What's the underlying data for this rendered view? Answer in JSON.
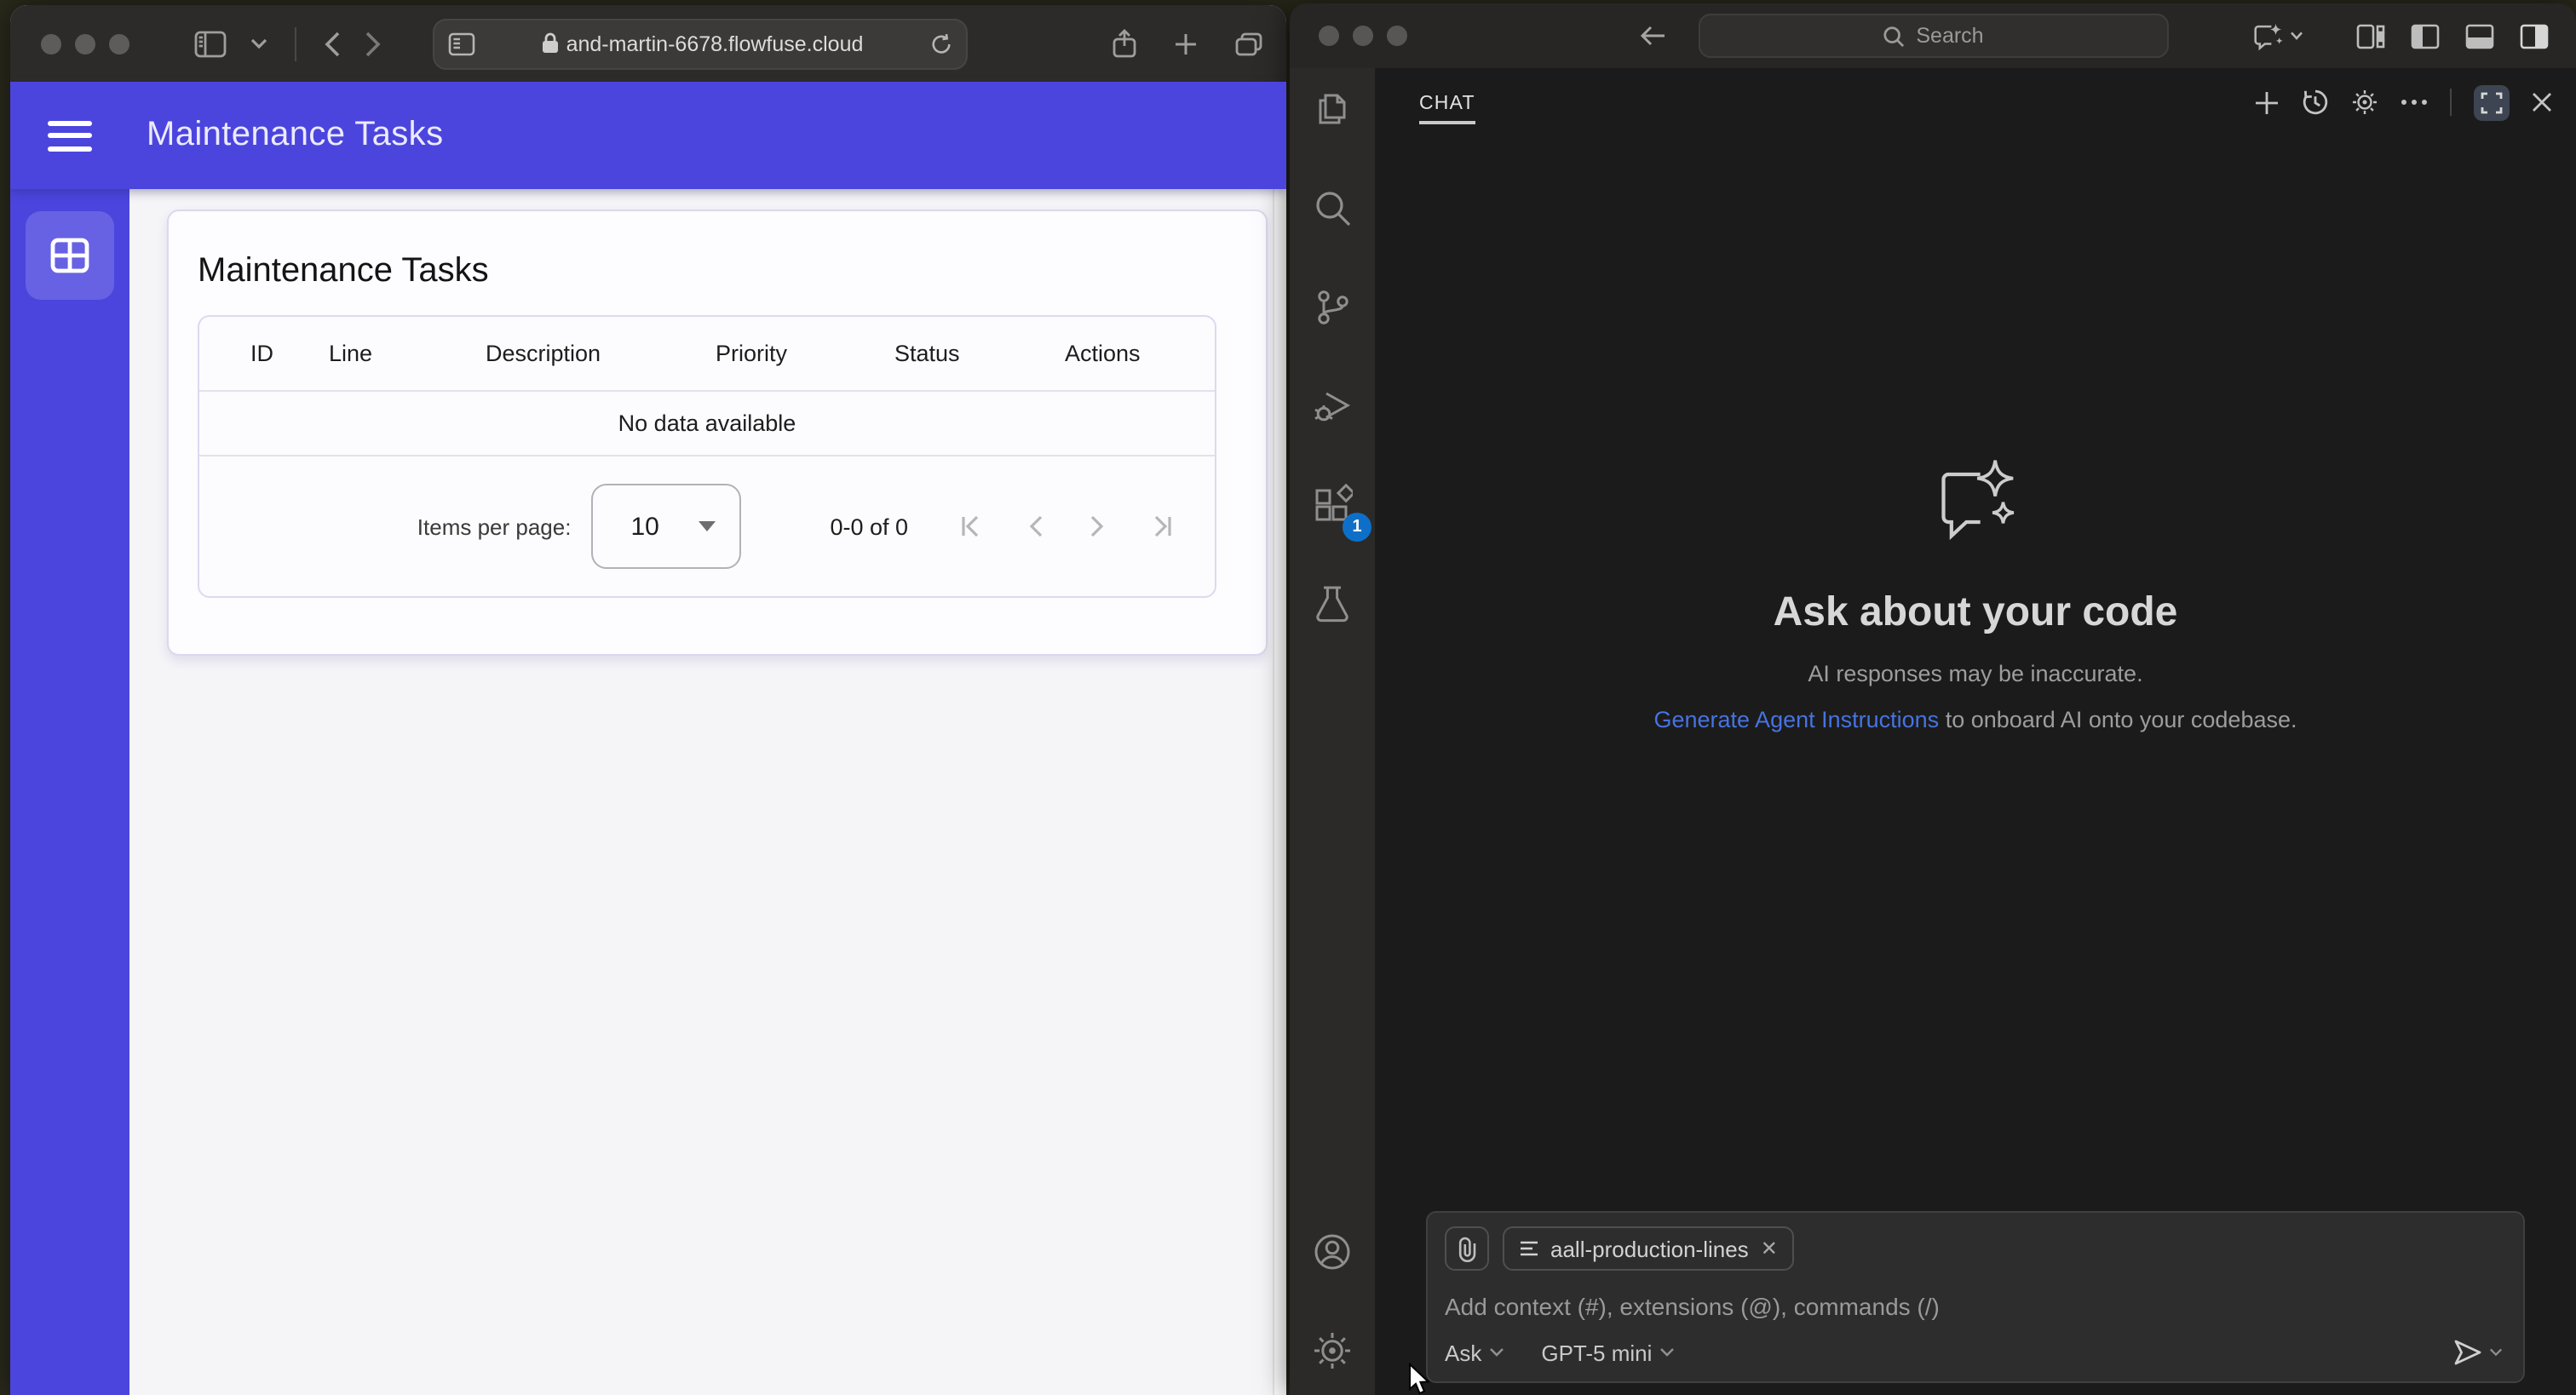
{
  "colors": {
    "app_primary_blue": "#4b45de",
    "vscode_badge_blue": "#0e6fc8",
    "link_blue": "#4673e1",
    "card_border": "#dbd8ee"
  },
  "browser": {
    "toolbar": {
      "url": "and-martin-6678.flowfuse.cloud"
    },
    "app": {
      "header_title": "Maintenance Tasks",
      "card_title": "Maintenance Tasks",
      "table": {
        "columns": [
          "ID",
          "Line",
          "Description",
          "Priority",
          "Status",
          "Actions"
        ],
        "empty_message": "No data available",
        "footer": {
          "items_per_page_label": "Items per page:",
          "items_per_page_value": "10",
          "range_text": "0-0 of 0"
        }
      }
    }
  },
  "vscode": {
    "titlebar": {
      "search_placeholder": "Search"
    },
    "activity_bar": {
      "items": [
        "explorer-icon",
        "search-icon",
        "source-control-icon",
        "run-debug-icon",
        "extensions-icon",
        "testing-icon",
        "account-icon",
        "settings-gear-icon"
      ],
      "extensions_badge": "1"
    },
    "chat": {
      "tab_label": "CHAT",
      "empty_state": {
        "title": "Ask about your code",
        "subtitle": "AI responses may be inaccurate.",
        "link_text": "Generate Agent Instructions",
        "link_suffix": " to onboard AI onto your codebase."
      },
      "input": {
        "context_chip": "aall-production-lines",
        "chip_close": "✕",
        "placeholder": "Add context (#), extensions (@), commands (/)",
        "mode_label": "Ask",
        "model_label": "GPT-5 mini"
      }
    }
  }
}
